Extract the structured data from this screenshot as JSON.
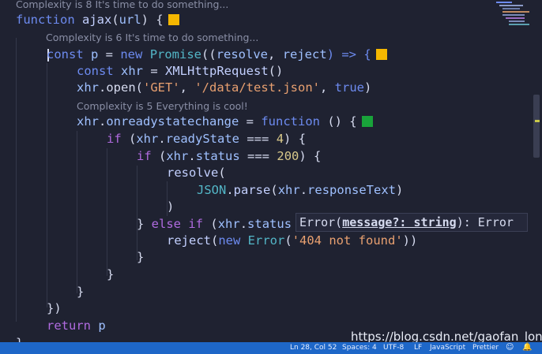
{
  "code_lens": {
    "outer": "Complexity is 8 It's time to do something...",
    "promise": "Complexity is 6 It's time to do something...",
    "onready": "Complexity is 5 Everything is cool!"
  },
  "complexity_colors": {
    "warn": "#f5b700",
    "ok": "#19a33a"
  },
  "code": {
    "l1": {
      "a": "function",
      "b": " ajax",
      "c": "(",
      "d": "url",
      "e": ") {"
    },
    "l2": {
      "a": "const",
      "b": " p ",
      "c": "=",
      "d": " new ",
      "e": "Promise",
      "f": "((",
      "g": "resolve",
      "h": ", ",
      "i": "reject",
      "j": ") => {"
    },
    "l3": {
      "a": "const",
      "b": " xhr ",
      "c": "=",
      "d": " XMLHttpRequest",
      "e": "()"
    },
    "l4": {
      "a": "xhr",
      "b": ".open(",
      "c": "'GET'",
      "d": ", ",
      "e": "'/data/test.json'",
      "f": ", ",
      "g": "true",
      "h": ")"
    },
    "l5": {
      "a": "xhr",
      "b": ".",
      "c": "onreadystatechange",
      "d": " = ",
      "e": "function",
      "f": " () {"
    },
    "l6": {
      "a": "if",
      "b": " (",
      "c": "xhr",
      "d": ".",
      "e": "readyState",
      "f": " === ",
      "g": "4",
      "h": ") {"
    },
    "l7": {
      "a": "if",
      "b": " (",
      "c": "xhr",
      "d": ".",
      "e": "status",
      "f": " === ",
      "g": "200",
      "h": ") {"
    },
    "l8": {
      "a": "resolve",
      "b": "("
    },
    "l9": {
      "a": "JSON",
      "b": ".",
      "c": "parse",
      "d": "(",
      "e": "xhr",
      "f": ".",
      "g": "responseText",
      "h": ")"
    },
    "l10": {
      "a": ")"
    },
    "l11": {
      "a": "} ",
      "b": "else",
      "c": " ",
      "d": "if",
      "e": " (",
      "f": "xhr",
      "g": ".",
      "h": "status"
    },
    "l12": {
      "a": "reject",
      "b": "(",
      "c": "new",
      "d": " Error",
      "e": "(",
      "f": "'404 not found'",
      "g": "))"
    },
    "l13": {
      "a": "}"
    },
    "l14": {
      "a": "}"
    },
    "l15": {
      "a": "}"
    },
    "l16": {
      "a": "})"
    },
    "l17": {
      "a": "return",
      "b": " p"
    },
    "l18": {
      "a": "}"
    }
  },
  "tooltip": {
    "a": "Error(",
    "b": "message?: string",
    "c": "): Error"
  },
  "statusbar": {
    "position": "Ln 28, Col 52",
    "spaces": "Spaces: 4",
    "encoding": "UTF-8",
    "eol": "LF",
    "language": "JavaScript",
    "formatter": "Prettier"
  },
  "watermark": "https://blog.csdn.net/gaofan_long"
}
